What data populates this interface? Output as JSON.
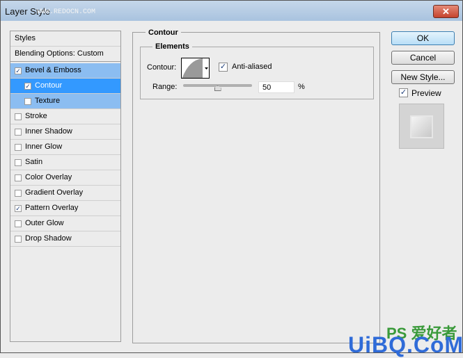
{
  "window": {
    "title": "Layer Style",
    "watermark": "WWW.REDOCN.COM",
    "close": "✕"
  },
  "sidebar": {
    "header": "Styles",
    "blending": "Blending Options: Custom",
    "items": [
      {
        "label": "Bevel & Emboss",
        "checked": true
      },
      {
        "label": "Contour",
        "checked": true
      },
      {
        "label": "Texture",
        "checked": false
      },
      {
        "label": "Stroke",
        "checked": false
      },
      {
        "label": "Inner Shadow",
        "checked": false
      },
      {
        "label": "Inner Glow",
        "checked": false
      },
      {
        "label": "Satin",
        "checked": false
      },
      {
        "label": "Color Overlay",
        "checked": false
      },
      {
        "label": "Gradient Overlay",
        "checked": false
      },
      {
        "label": "Pattern Overlay",
        "checked": true
      },
      {
        "label": "Outer Glow",
        "checked": false
      },
      {
        "label": "Drop Shadow",
        "checked": false
      }
    ]
  },
  "contour": {
    "group": "Contour",
    "elements": "Elements",
    "contour_label": "Contour:",
    "anti_aliased": "Anti-aliased",
    "anti_aliased_checked": true,
    "range_label": "Range:",
    "range_value": "50",
    "range_unit": "%",
    "range_percent": 50
  },
  "buttons": {
    "ok": "OK",
    "cancel": "Cancel",
    "new_style": "New Style...",
    "preview": "Preview",
    "preview_checked": true
  },
  "watermarks": {
    "ps": "PS 爱好者",
    "uibq": "UiBQ.CoM"
  }
}
